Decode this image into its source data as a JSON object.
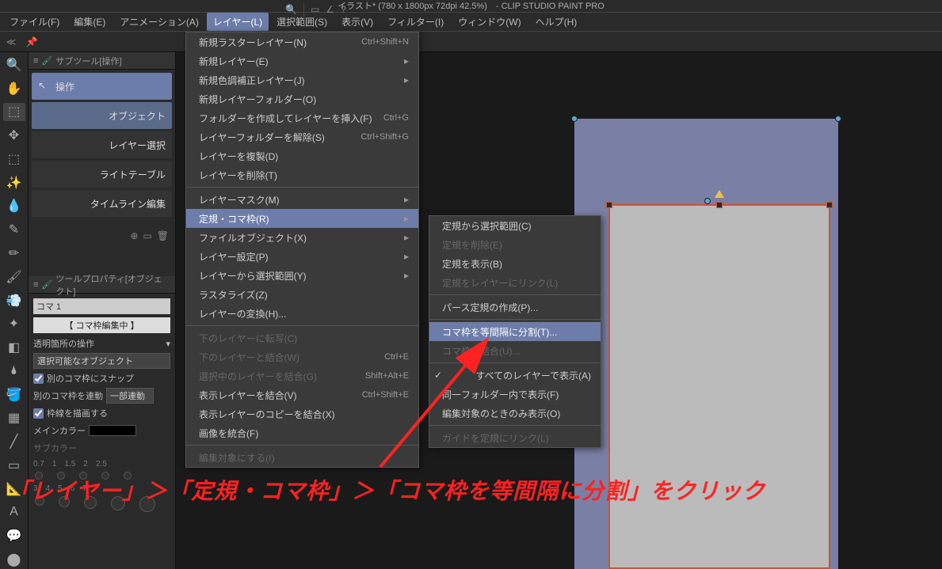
{
  "title": "イラスト* (780 x 1800px 72dpi 42.5%)　- CLIP STUDIO PAINT PRO",
  "menubar": {
    "file": "ファイル(F)",
    "edit": "編集(E)",
    "animation": "アニメーション(A)",
    "layer": "レイヤー(L)",
    "selection": "選択範囲(S)",
    "view": "表示(V)",
    "filter": "フィルター(I)",
    "window": "ウィンドウ(W)",
    "help": "ヘルプ(H)"
  },
  "subtool": {
    "header": "サブツール[操作]",
    "items": {
      "operate": "操作",
      "object": "オブジェクト",
      "layer_select": "レイヤー選択",
      "light_table": "ライトテーブル",
      "timeline_edit": "タイムライン編集"
    }
  },
  "tool_property": {
    "header": "ツールプロパティ[オブジェクト]",
    "koma_tab": "コマ 1",
    "editing": "【 コマ枠編集中 】",
    "rows": {
      "transparent_op": "透明箇所の操作",
      "selectable": "選択可能なオブジェクト",
      "snap_other": "別のコマ枠にスナップ",
      "link_other": "別のコマ枠を連動",
      "link_value": "一部連動",
      "draw_border": "枠線を描画する",
      "main_color": "メインカラー",
      "sub_color": "サブカラー"
    },
    "brush_sizes": [
      "0.7",
      "1",
      "1.5",
      "2",
      "2.5",
      "3",
      "4",
      "5",
      "6",
      "7"
    ]
  },
  "layer_menu": {
    "new_raster": {
      "label": "新規ラスターレイヤー(N)",
      "shortcut": "Ctrl+Shift+N"
    },
    "new_layer": {
      "label": "新規レイヤー(E)"
    },
    "new_correction": {
      "label": "新規色調補正レイヤー(J)"
    },
    "new_folder": {
      "label": "新規レイヤーフォルダー(O)"
    },
    "create_folder_insert": {
      "label": "フォルダーを作成してレイヤーを挿入(F)",
      "shortcut": "Ctrl+G"
    },
    "unfold_folder": {
      "label": "レイヤーフォルダーを解除(S)",
      "shortcut": "Ctrl+Shift+G"
    },
    "duplicate": {
      "label": "レイヤーを複製(D)"
    },
    "delete": {
      "label": "レイヤーを削除(T)"
    },
    "mask": {
      "label": "レイヤーマスク(M)"
    },
    "ruler_frame": {
      "label": "定規・コマ枠(R)"
    },
    "file_object": {
      "label": "ファイルオブジェクト(X)"
    },
    "settings": {
      "label": "レイヤー設定(P)"
    },
    "from_selection": {
      "label": "レイヤーから選択範囲(Y)"
    },
    "rasterize": {
      "label": "ラスタライズ(Z)"
    },
    "convert": {
      "label": "レイヤーの変換(H)..."
    },
    "transfer_down": {
      "label": "下のレイヤーに転写(C)"
    },
    "merge_down": {
      "label": "下のレイヤーと結合(W)",
      "shortcut": "Ctrl+E"
    },
    "merge_selected": {
      "label": "選択中のレイヤーを結合(G)",
      "shortcut": "Shift+Alt+E"
    },
    "merge_visible": {
      "label": "表示レイヤーを結合(V)",
      "shortcut": "Ctrl+Shift+E"
    },
    "merge_visible_copy": {
      "label": "表示レイヤーのコピーを結合(X)"
    },
    "flatten": {
      "label": "画像を統合(F)"
    },
    "edit_target": {
      "label": "編集対象にする(I)"
    }
  },
  "ruler_submenu": {
    "select_from_ruler": "定規から選択範囲(C)",
    "delete_ruler": "定規を削除(E)",
    "show_ruler": "定規を表示(B)",
    "link_ruler": "定規をレイヤーにリンク(L)",
    "create_perspective": "パース定規の作成(P)...",
    "divide_frame": "コマ枠を等間隔に分割(T)...",
    "merge_frame": "コマ枠を結合(U)...",
    "show_all_layers": "すべてのレイヤーで表示(A)",
    "show_same_folder": "同一フォルダー内で表示(F)",
    "show_only_edit": "編集対象のときのみ表示(O)",
    "link_guide_ruler": "ガイドを定規にリンク(L)"
  },
  "instruction": "「レイヤー」＞「定規・コマ枠」＞「コマ枠を等間隔に分割」をクリック"
}
